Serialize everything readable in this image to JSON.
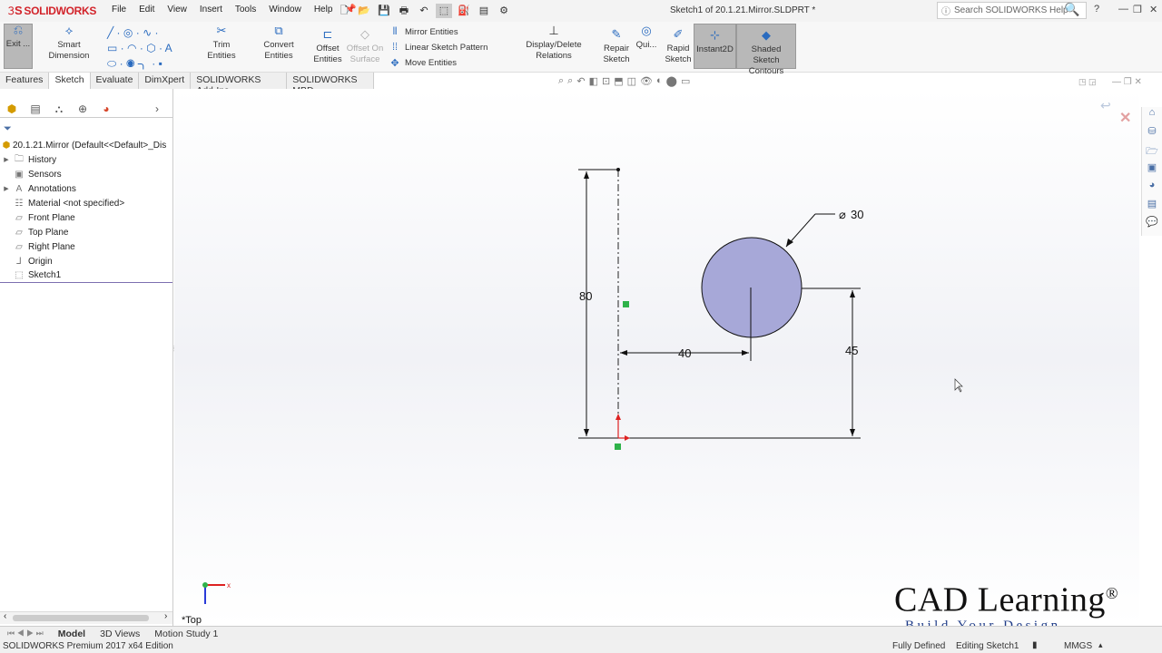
{
  "titlebar": {
    "brand": "SOLIDWORKS",
    "menus": [
      "File",
      "Edit",
      "View",
      "Insert",
      "Tools",
      "Window",
      "Help"
    ],
    "doc_title": "Sketch1 of 20.1.21.Mirror.SLDPRT *",
    "search_placeholder": "Search SOLIDWORKS Help"
  },
  "command_manager": {
    "exit": "Exit ...",
    "smart_dimension": "Smart Dimension",
    "trim": "Trim Entities",
    "convert": "Convert Entities",
    "offset": "Offset Entities",
    "offset_surface": "Offset On Surface",
    "mirror": "Mirror Entities",
    "linear_pattern": "Linear Sketch Pattern",
    "move": "Move Entities",
    "display_relations": "Display/Delete Relations",
    "repair": "Repair Sketch",
    "quick": "Qui...",
    "rapid": "Rapid Sketch",
    "instant2d": "Instant2D",
    "shaded": "Shaded Sketch Contours"
  },
  "tabs": [
    "Features",
    "Sketch",
    "Evaluate",
    "DimXpert",
    "SOLIDWORKS Add-Ins",
    "SOLIDWORKS MBD"
  ],
  "active_tab": "Sketch",
  "tree": {
    "root": "20.1.21.Mirror  (Default<<Default>_Dis",
    "items": [
      {
        "label": "History",
        "expandable": true,
        "icon": "history-icon"
      },
      {
        "label": "Sensors",
        "expandable": false,
        "icon": "sensor-icon"
      },
      {
        "label": "Annotations",
        "expandable": true,
        "icon": "annotation-icon"
      },
      {
        "label": "Material <not specified>",
        "expandable": false,
        "icon": "material-icon"
      },
      {
        "label": "Front Plane",
        "expandable": false,
        "icon": "plane-icon"
      },
      {
        "label": "Top Plane",
        "expandable": false,
        "icon": "plane-icon"
      },
      {
        "label": "Right Plane",
        "expandable": false,
        "icon": "plane-icon"
      },
      {
        "label": "Origin",
        "expandable": false,
        "icon": "origin-icon"
      },
      {
        "label": "Sketch1",
        "expandable": false,
        "icon": "sketch-icon"
      }
    ]
  },
  "sketch": {
    "dims": {
      "height": "80",
      "horizontal": "40",
      "vertical": "45",
      "diameter": "30"
    },
    "circle_fill": "#a7a8d8",
    "view_label": "*Top"
  },
  "bottom_tabs": [
    "Model",
    "3D Views",
    "Motion Study 1"
  ],
  "status": {
    "edition": "SOLIDWORKS Premium 2017 x64 Edition",
    "defined": "Fully Defined",
    "editing": "Editing Sketch1",
    "units": "MMGS"
  },
  "watermark": {
    "title": "CAD Learning",
    "reg": "®",
    "tagline": "Build Your Design"
  }
}
